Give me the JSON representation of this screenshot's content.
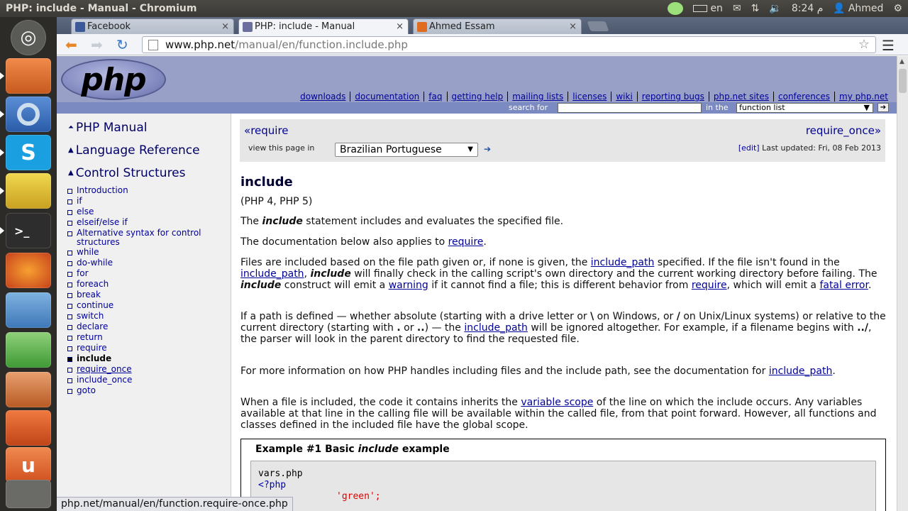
{
  "window": {
    "title": "PHP: include - Manual - Chromium"
  },
  "indicators": {
    "keyboard": "en",
    "clock": "8:24 م",
    "user": "Ahmed"
  },
  "tabs": [
    {
      "label": "Facebook",
      "active": false,
      "favicon_color": "#3b5998"
    },
    {
      "label": "PHP: include - Manual",
      "active": true,
      "favicon_color": "#6b6f9e"
    },
    {
      "label": "Ahmed Essam",
      "active": false,
      "favicon_color": "#e06c1f"
    }
  ],
  "omnibox": {
    "host": "www.php.net",
    "path": "/manual/en/function.include.php"
  },
  "php_header": {
    "logo_text": "php",
    "nav": [
      "downloads",
      "documentation",
      "faq",
      "getting help",
      "mailing lists",
      "licenses",
      "wiki",
      "reporting bugs",
      "php.net sites",
      "conferences",
      "my php.net"
    ],
    "search_for_label": "search for",
    "in_the_label": "in the",
    "search_scope": "function list"
  },
  "sidebar": {
    "headers": [
      "PHP Manual",
      "Language Reference",
      "Control Structures"
    ],
    "items": [
      "Introduction",
      "if",
      "else",
      "elseif/else if",
      "Alternative syntax for control structures",
      "while",
      "do-while",
      "for",
      "foreach",
      "break",
      "continue",
      "switch",
      "declare",
      "return",
      "require",
      "include",
      "require_once",
      "include_once",
      "goto"
    ]
  },
  "prevnext": {
    "prev": "require",
    "next": "require_once",
    "view_page_in": "view this page in",
    "language": "Brazilian Portuguese",
    "edit": "[edit]",
    "last_updated": "Last updated: Fri, 08 Feb 2013"
  },
  "content": {
    "title": "include",
    "versions": "(PHP 4, PHP 5)",
    "p1_a": "The ",
    "p1_b": "include",
    "p1_c": " statement includes and evaluates the specified file.",
    "p2_a": "The documentation below also applies to ",
    "p2_link": "require",
    "p2_b": ".",
    "p3_1": "Files are included based on the file path given or, if none is given, the ",
    "p3_link1": "include_path",
    "p3_2": " specified. If the file isn't found in the ",
    "p3_link2": "include_path",
    "p3_3": ", ",
    "p3_kw1": "include",
    "p3_4": " will finally check in the calling script's own directory and the current working directory before failing. The ",
    "p3_kw2": "include",
    "p3_5": " construct will emit a ",
    "p3_link3": "warning",
    "p3_6": " if it cannot find a file; this is different behavior from ",
    "p3_link4": "require",
    "p3_7": ", which will emit a ",
    "p3_link5": "fatal error",
    "p3_8": ".",
    "p4_1": "If a path is defined — whether absolute (starting with a drive letter or ",
    "p4_bs": "\\",
    "p4_2": " on Windows, or ",
    "p4_sl": "/",
    "p4_3": " on Unix/Linux systems) or relative to the current directory (starting with ",
    "p4_dot": ".",
    "p4_4": " or ",
    "p4_dd": "..",
    "p4_5": ") — the ",
    "p4_link": "include_path",
    "p4_6": " will be ignored altogether. For example, if a filename begins with ",
    "p4_rel": "../",
    "p4_7": ", the parser will look in the parent directory to find the requested file.",
    "p5_1": "For more information on how PHP handles including files and the include path, see the documentation for ",
    "p5_link": "include_path",
    "p5_2": ".",
    "p6_1": "When a file is included, the code it contains inherits the ",
    "p6_link": "variable scope",
    "p6_2": " of the line on which the include occurs. Any variables available at that line in the calling file will be available within the called file, from that point forward. However, all functions and classes defined in the included file have the global scope."
  },
  "example": {
    "title_a": "Example #1 Basic ",
    "title_b": "include",
    "title_c": " example",
    "line1": "vars.php",
    "line2": "<?php",
    "line3": "'green';"
  },
  "statusbar": {
    "url": "php.net/manual/en/function.require-once.php"
  }
}
